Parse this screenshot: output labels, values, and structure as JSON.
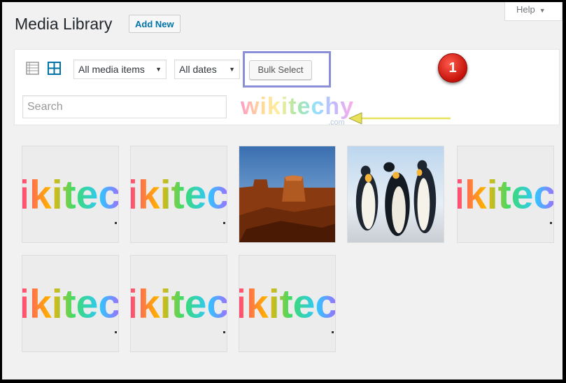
{
  "header": {
    "title": "Media Library",
    "add_new_label": "Add New",
    "help_label": "Help"
  },
  "toolbar": {
    "view_list_icon": "list-view-icon",
    "view_grid_icon": "grid-view-icon",
    "media_filter": "All media items",
    "date_filter": "All dates",
    "bulk_select_label": "Bulk Select",
    "search_placeholder": "Search",
    "watermark_text": "wikitechy",
    "watermark_sub": ".com"
  },
  "annotation": {
    "badge_number": "1",
    "arrow_color": "#e8e15a",
    "highlight_color": "#8b8fd9"
  },
  "media_items": [
    {
      "type": "wikitechy-logo",
      "text": "ikitec"
    },
    {
      "type": "wikitechy-logo",
      "text": "ikitec"
    },
    {
      "type": "photo",
      "subject": "desert-mesa"
    },
    {
      "type": "photo",
      "subject": "penguins"
    },
    {
      "type": "wikitechy-logo",
      "text": "ikitec"
    },
    {
      "type": "wikitechy-logo",
      "text": "ikitec"
    },
    {
      "type": "wikitechy-logo",
      "text": "ikitec"
    },
    {
      "type": "wikitechy-logo",
      "text": "ikitec"
    }
  ],
  "colors": {
    "accent": "#0073aa",
    "background": "#f1f1f1"
  }
}
